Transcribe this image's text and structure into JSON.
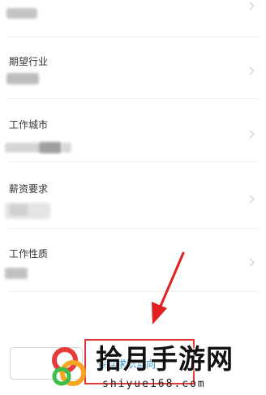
{
  "fields": [
    {
      "label": ""
    },
    {
      "label": "期望行业"
    },
    {
      "label": "工作城市"
    },
    {
      "label": "薪资要求"
    },
    {
      "label": "工作性质"
    }
  ],
  "confirm_button": {
    "label": "保存求职意向"
  },
  "watermark": {
    "title": "拾月手游网",
    "url": "shiyue168.com"
  },
  "colors": {
    "highlight": "#e23a3a",
    "arrow": "#e02020",
    "link": "#1e86c8"
  }
}
